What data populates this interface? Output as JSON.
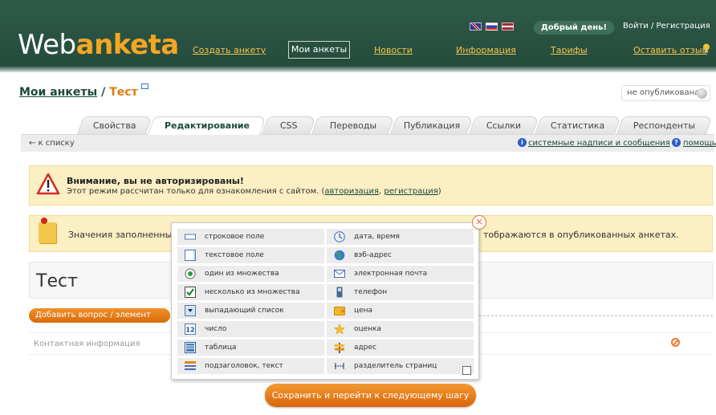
{
  "header": {
    "logo_a": "Web",
    "logo_b": "anketa",
    "nav": [
      "Создать анкету",
      "Мои анкеты",
      "Новости",
      "Информация",
      "Тарифы",
      "Оставить отзыв"
    ],
    "greeting": "Добрый день!",
    "login": "Войти / Регистрация"
  },
  "breadcrumb": {
    "link": "Мои анкеты",
    "sep": "/",
    "current": "Тест"
  },
  "pub_status": "не опубликована",
  "tabs": [
    "Свойства",
    "Редактирование",
    "CSS",
    "Переводы",
    "Публикация",
    "Ссылки",
    "Статистика",
    "Респонденты"
  ],
  "subbar": {
    "back": "← к списку",
    "sys": "системные надписи и сообщения",
    "help": "помощь"
  },
  "warning": {
    "title": "Внимание, вы не авторизированы!",
    "text": "Этот режим рассчитан только для ознакомления с сайтом. (",
    "auth": "авторизация",
    "comma": ",",
    "reg": "регистрация",
    "close": ")"
  },
  "note": {
    "left": "Значения заполненных",
    "right": "тображаются в опубликованных анкетах."
  },
  "form_title": "Тест",
  "add_button": "Добавить вопрос / элемент",
  "contact": "Контактная информация",
  "save_button": "Сохранить и перейти к следующему шагу",
  "menu": {
    "left": [
      "строковое поле",
      "текстовое поле",
      "один из множества",
      "несколько из множества",
      "выпадающий список",
      "число",
      "таблица",
      "подзаголовок, текст"
    ],
    "right": [
      "дата, время",
      "вэб-адрес",
      "электронная почта",
      "телефон",
      "цена",
      "оценка",
      "адрес",
      "разделитель страниц"
    ],
    "number_icon": "12"
  },
  "colors": {
    "header": "#2f5a49",
    "accent": "#f5a623",
    "orange": "#e07a10"
  }
}
